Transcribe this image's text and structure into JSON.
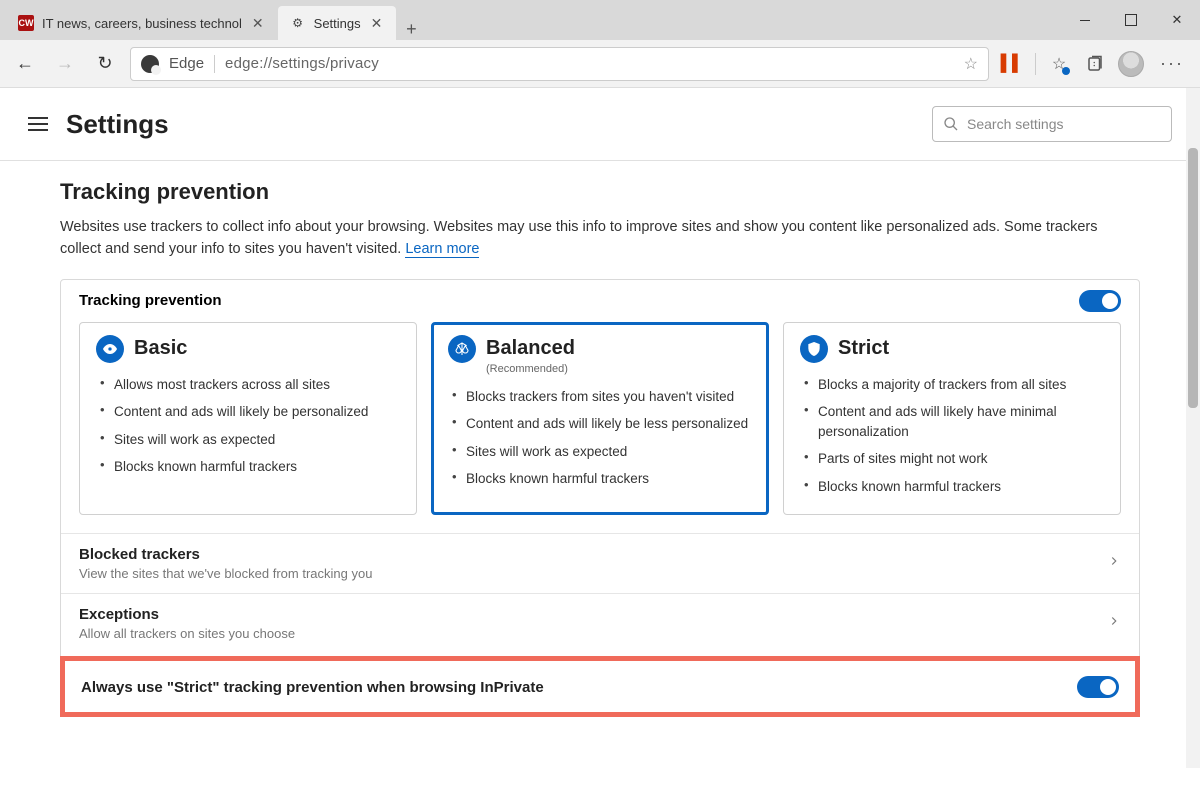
{
  "window": {
    "min": "Minimize",
    "max": "Maximize",
    "close": "Close"
  },
  "tabs": {
    "items": [
      {
        "title": "IT news, careers, business technol",
        "active": false,
        "favicon": "cw"
      },
      {
        "title": "Settings",
        "active": true,
        "favicon": "gear"
      }
    ],
    "newtab": "+"
  },
  "toolbar": {
    "back": "Back",
    "forward": "Forward",
    "reload": "Refresh",
    "browser_label": "Edge",
    "url": "edge://settings/privacy",
    "star": "Favorite",
    "icons": {
      "office": "Office",
      "favorites": "Favorites",
      "collections": "Collections",
      "profile": "Profile",
      "more": "···"
    }
  },
  "settingsHeader": {
    "menu": "Menu",
    "title": "Settings",
    "searchPlaceholder": "Search settings"
  },
  "tracking": {
    "title": "Tracking prevention",
    "desc": "Websites use trackers to collect info about your browsing. Websites may use this info to improve sites and show you content like personalized ads. Some trackers collect and send your info to sites you haven't visited. ",
    "learnMore": "Learn more",
    "cardHeader": "Tracking prevention",
    "toggleOn": true,
    "levels": [
      {
        "name": "Basic",
        "icon": "eye",
        "selected": false,
        "sub": "",
        "bullets": [
          "Allows most trackers across all sites",
          "Content and ads will likely be personalized",
          "Sites will work as expected",
          "Blocks known harmful trackers"
        ]
      },
      {
        "name": "Balanced",
        "icon": "scale",
        "selected": true,
        "sub": "(Recommended)",
        "bullets": [
          "Blocks trackers from sites you haven't visited",
          "Content and ads will likely be less personalized",
          "Sites will work as expected",
          "Blocks known harmful trackers"
        ]
      },
      {
        "name": "Strict",
        "icon": "shield",
        "selected": false,
        "sub": "",
        "bullets": [
          "Blocks a majority of trackers from all sites",
          "Content and ads will likely have minimal personalization",
          "Parts of sites might not work",
          "Blocks known harmful trackers"
        ]
      }
    ],
    "rows": [
      {
        "title": "Blocked trackers",
        "sub": "View the sites that we've blocked from tracking you",
        "type": "nav"
      },
      {
        "title": "Exceptions",
        "sub": "Allow all trackers on sites you choose",
        "type": "nav"
      },
      {
        "title": "Always use \"Strict\" tracking prevention when browsing InPrivate",
        "sub": "",
        "type": "toggle",
        "highlight": true,
        "on": true
      }
    ]
  }
}
